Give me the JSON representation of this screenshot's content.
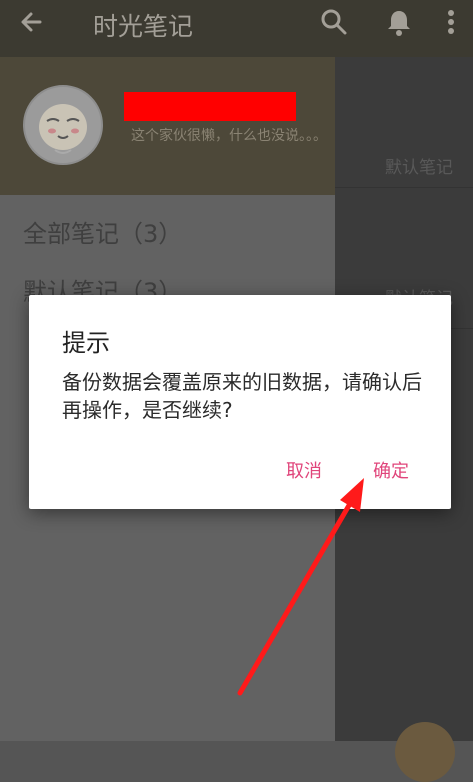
{
  "app_bar": {
    "back_icon": "arrow-left-icon",
    "title": "时光笔记",
    "search_icon": "search-icon",
    "bell_icon": "bell-icon",
    "more_icon": "more-vertical-icon"
  },
  "drawer": {
    "bio": "这个家伙很懒，什么也没说。。。",
    "items": [
      {
        "label": "全部笔记（3）"
      },
      {
        "label": "默认笔记（3）"
      }
    ]
  },
  "content": {
    "rows": [
      "默认笔记",
      "默认笔记"
    ]
  },
  "dialog": {
    "title": "提示",
    "message": "备份数据会覆盖原来的旧数据，请确认后再操作，是否继续?",
    "cancel": "取消",
    "confirm": "确定"
  },
  "colors": {
    "accent": "#e0457b",
    "annotation_arrow": "#ff1a1a"
  }
}
